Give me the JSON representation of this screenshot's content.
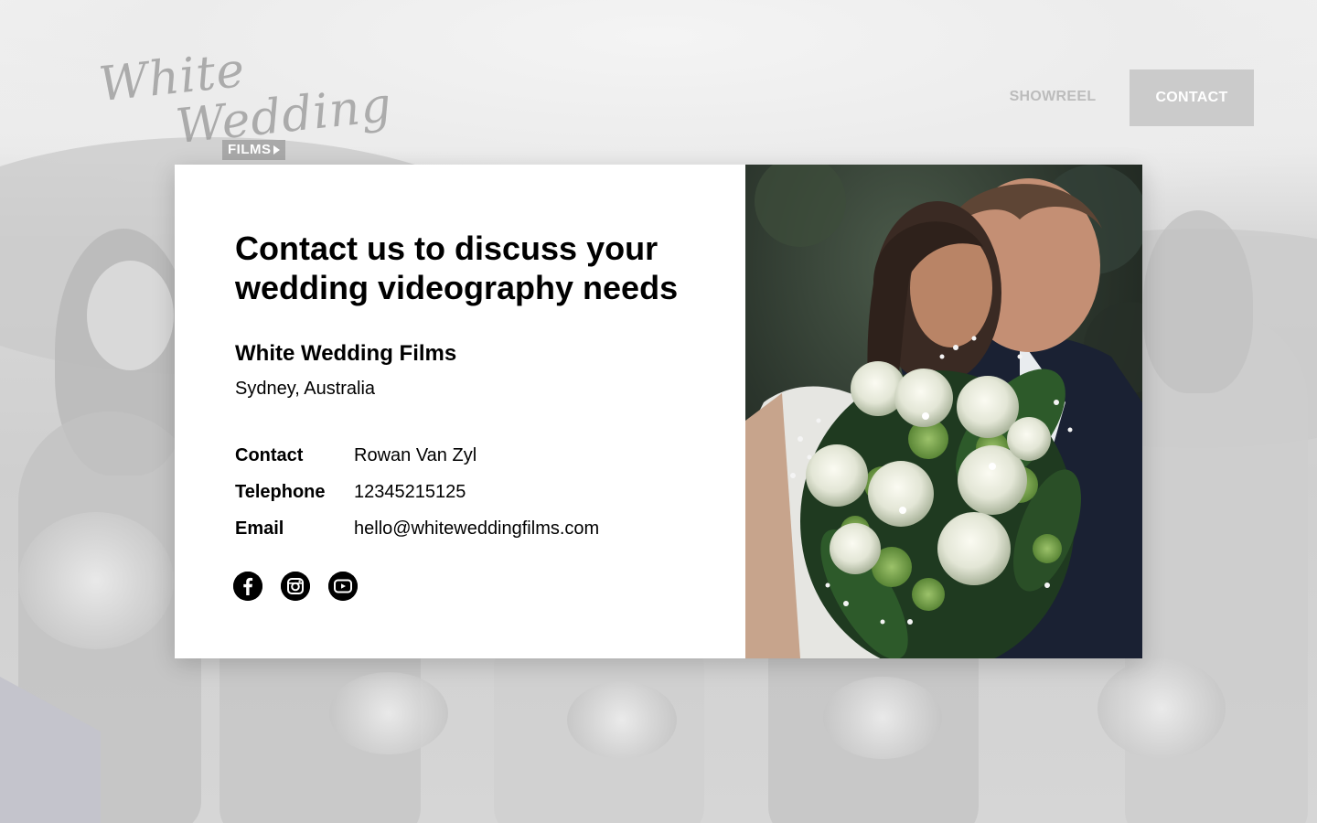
{
  "header": {
    "logo": {
      "script_line1": "White",
      "script_line2": "Wedding",
      "badge": "FILMS"
    },
    "nav": {
      "showreel_label": "SHOWREEL",
      "contact_label": "CONTACT"
    }
  },
  "contact_card": {
    "headline": "Contact us to discuss your wedding videography needs",
    "company_name": "White Wedding Films",
    "location": "Sydney, Australia",
    "details": [
      {
        "label": "Contact",
        "value": "Rowan Van Zyl"
      },
      {
        "label": "Telephone",
        "value": "12345215125"
      },
      {
        "label": "Email",
        "value": "hello@whiteweddingfilms.com"
      }
    ],
    "socials": [
      {
        "icon": "facebook-icon"
      },
      {
        "icon": "instagram-icon"
      },
      {
        "icon": "youtube-icon"
      }
    ]
  },
  "colors": {
    "nav_button_bg": "#cbcbcb",
    "nav_link": "#bcbcbc",
    "text": "#000000",
    "card_bg": "#ffffff"
  }
}
